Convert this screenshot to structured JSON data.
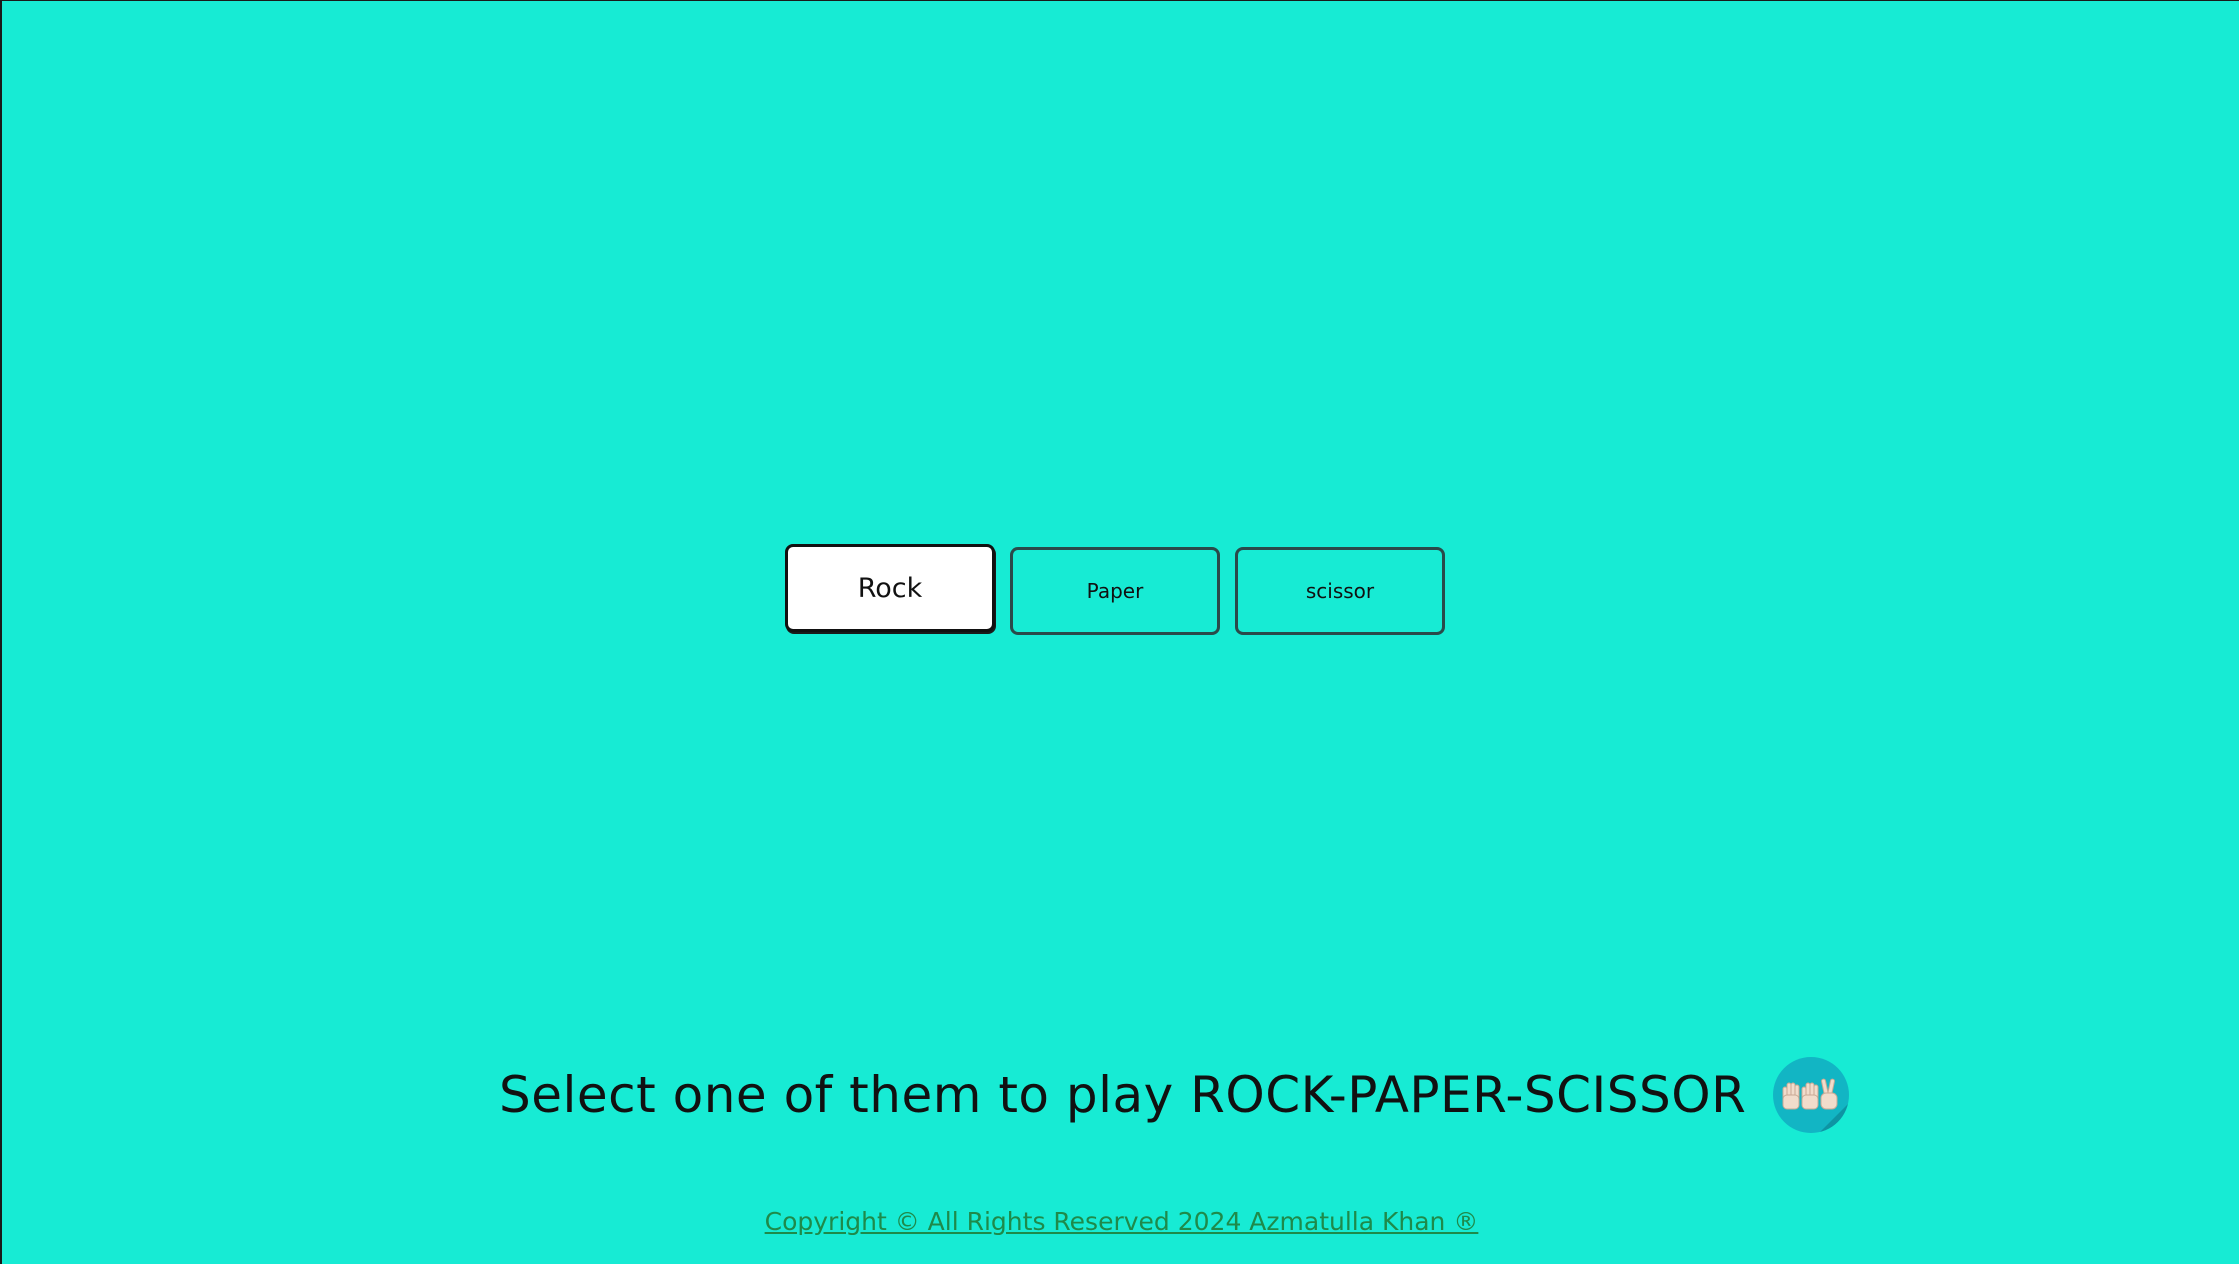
{
  "choices": {
    "rock_label": "Rock",
    "paper_label": "Paper",
    "scissor_label": "scissor"
  },
  "prompt": {
    "text": "Select one of them to play ROCK-PAPER-SCISSOR",
    "icon": "rock-paper-scissors-hands-icon"
  },
  "footer": {
    "copyright": "Copyright © All Rights Reserved 2024 Azmatulla Khan ®"
  },
  "colors": {
    "background": "#17EBD4",
    "footer_link": "#1E8A4A",
    "icon_circle": "#12B5C4"
  }
}
